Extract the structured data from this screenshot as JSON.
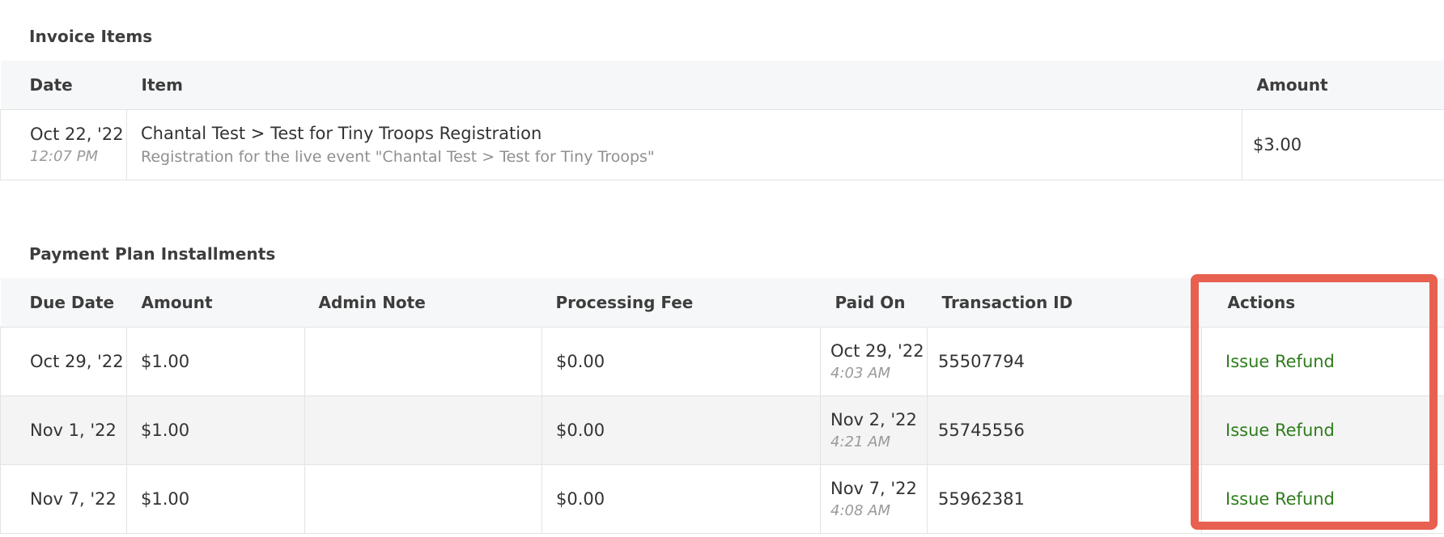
{
  "invoice_items": {
    "title": "Invoice Items",
    "columns": [
      "Date",
      "Item",
      "Amount"
    ],
    "rows": [
      {
        "date": "Oct 22, '22",
        "time": "12:07 PM",
        "item": "Chantal Test > Test for Tiny Troops Registration",
        "description": "Registration for the live event \"Chantal Test > Test for Tiny Troops\"",
        "amount": "$3.00"
      }
    ]
  },
  "installments": {
    "title": "Payment Plan Installments",
    "columns": [
      "Due Date",
      "Amount",
      "Admin Note",
      "Processing Fee",
      "Paid On",
      "Transaction ID",
      "Actions"
    ],
    "rows": [
      {
        "due_date": "Oct 29, '22",
        "amount": "$1.00",
        "admin_note": "",
        "processing_fee": "$0.00",
        "paid_on": "Oct 29, '22",
        "paid_time": "4:03 AM",
        "transaction_id": "55507794",
        "action": "Issue Refund"
      },
      {
        "due_date": "Nov 1, '22",
        "amount": "$1.00",
        "admin_note": "",
        "processing_fee": "$0.00",
        "paid_on": "Nov 2, '22",
        "paid_time": "4:21 AM",
        "transaction_id": "55745556",
        "action": "Issue Refund"
      },
      {
        "due_date": "Nov 7, '22",
        "amount": "$1.00",
        "admin_note": "",
        "processing_fee": "$0.00",
        "paid_on": "Nov 7, '22",
        "paid_time": "4:08 AM",
        "transaction_id": "55962381",
        "action": "Issue Refund"
      }
    ]
  },
  "colors": {
    "action_link": "#2e7d1c",
    "highlight": "#e8604f",
    "header_bg": "#f6f7f8"
  }
}
